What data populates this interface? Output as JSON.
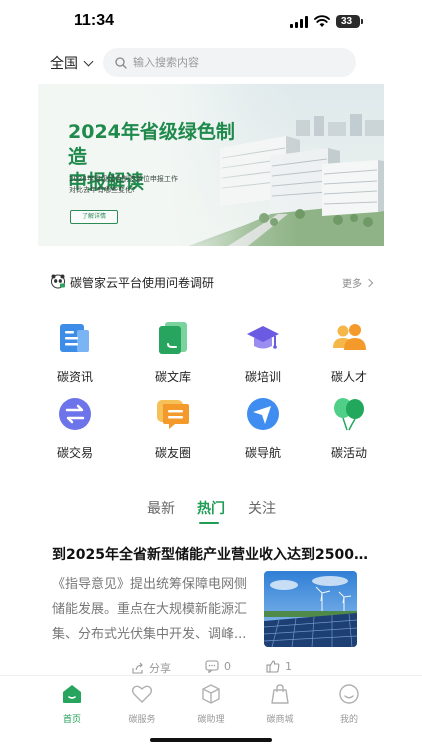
{
  "status_bar": {
    "time": "11:34",
    "battery": "33"
  },
  "search": {
    "region": "全国",
    "placeholder": "输入搜索内容"
  },
  "banner": {
    "title_line1": "2024年省级绿色制造",
    "title_line2": "申报解读",
    "subtitle_line1": "2024年省级绿色制造单位申报工作",
    "subtitle_line2": "对比去年有哪些变化?",
    "button": "了解详情"
  },
  "notice": {
    "text": "碳管家云平台使用问卷调研",
    "more": "更多"
  },
  "grid": [
    {
      "label": "碳资讯",
      "icon": "news-icon"
    },
    {
      "label": "碳文库",
      "icon": "library-icon"
    },
    {
      "label": "碳培训",
      "icon": "graduation-cap-icon"
    },
    {
      "label": "碳人才",
      "icon": "people-icon"
    },
    {
      "label": "碳交易",
      "icon": "exchange-icon"
    },
    {
      "label": "碳友圈",
      "icon": "chat-icon"
    },
    {
      "label": "碳导航",
      "icon": "navigation-icon"
    },
    {
      "label": "碳活动",
      "icon": "balloons-icon"
    }
  ],
  "tabs": [
    {
      "label": "最新",
      "active": false
    },
    {
      "label": "热门",
      "active": true
    },
    {
      "label": "关注",
      "active": false
    }
  ],
  "article": {
    "title": "到2025年全省新型储能产业营业收入达到2500亿元...",
    "description": "《指导意见》提出统筹保障电网侧储能发展。重点在大规模新能源汇集、分布式光伏集中开发、调峰...",
    "share_label": "分享",
    "comment_count": "0",
    "like_count": "1"
  },
  "tabbar": [
    {
      "label": "首页",
      "icon": "home-icon",
      "active": true
    },
    {
      "label": "碳服务",
      "icon": "heart-icon",
      "active": false
    },
    {
      "label": "碳助理",
      "icon": "box-icon",
      "active": false
    },
    {
      "label": "碳商城",
      "icon": "shopping-bag-icon",
      "active": false
    },
    {
      "label": "我的",
      "icon": "smiley-icon",
      "active": false
    }
  ],
  "colors": {
    "brand_green": "#1f9d55",
    "banner_title": "#1f8a4c"
  }
}
